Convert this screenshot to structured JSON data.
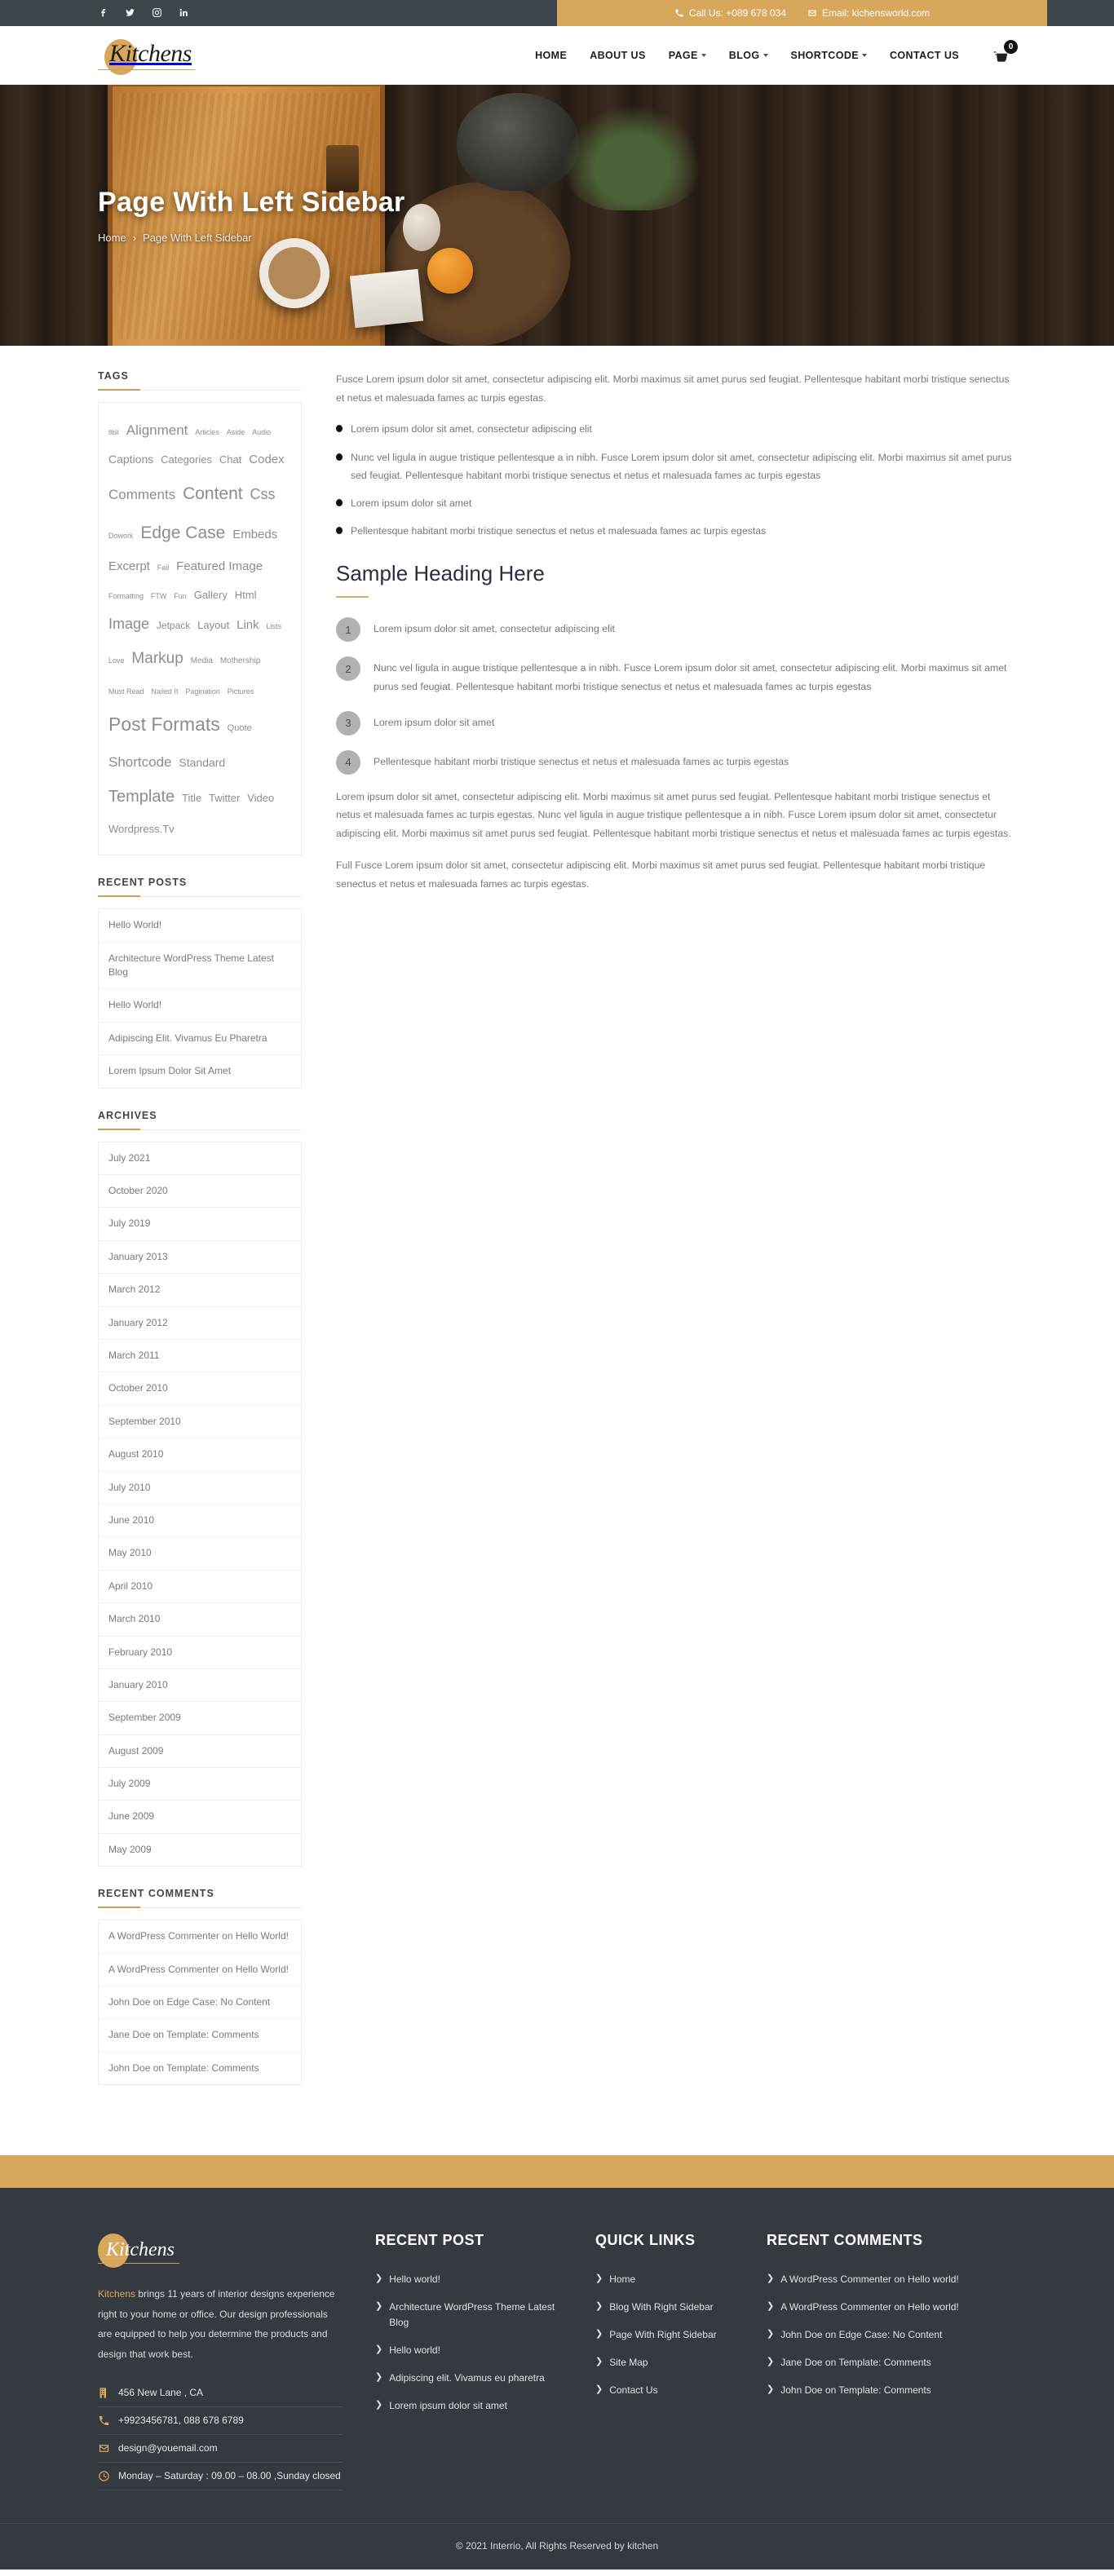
{
  "topbar": {
    "social": [
      {
        "name": "facebook-icon",
        "glyph": "f"
      },
      {
        "name": "twitter-icon",
        "glyph": "t"
      },
      {
        "name": "instagram-icon",
        "glyph": "i"
      },
      {
        "name": "linkedin-icon",
        "glyph": "in"
      }
    ],
    "phone": "Call Us: +089 678 034",
    "email": "Email: kichensworld.com"
  },
  "header": {
    "logo": "Kitchens",
    "nav": [
      {
        "label": "HOME",
        "caret": false
      },
      {
        "label": "ABOUT US",
        "caret": false
      },
      {
        "label": "PAGE",
        "caret": true
      },
      {
        "label": "BLOG",
        "caret": true
      },
      {
        "label": "SHORTCODE",
        "caret": true
      },
      {
        "label": "CONTACT US",
        "caret": false
      }
    ],
    "cart_count": "0"
  },
  "hero": {
    "title": "Page With Left Sidebar",
    "breadcrumb_home": "Home",
    "breadcrumb_sep": "›",
    "breadcrumb_current": "Page With Left Sidebar"
  },
  "sidebar": {
    "tags_title": "TAGS",
    "tags": [
      {
        "label": "8bit",
        "size": 8
      },
      {
        "label": "Alignment",
        "size": 17
      },
      {
        "label": "Articles",
        "size": 9
      },
      {
        "label": "Aside",
        "size": 9
      },
      {
        "label": "Audio",
        "size": 9
      },
      {
        "label": "Captions",
        "size": 14
      },
      {
        "label": "Categories",
        "size": 13
      },
      {
        "label": "Chat",
        "size": 13
      },
      {
        "label": "Codex",
        "size": 15
      },
      {
        "label": "Comments",
        "size": 17
      },
      {
        "label": "Content",
        "size": 21
      },
      {
        "label": "Css",
        "size": 18
      },
      {
        "label": "Dowork",
        "size": 9
      },
      {
        "label": "Edge Case",
        "size": 21
      },
      {
        "label": "Embeds",
        "size": 15
      },
      {
        "label": "Excerpt",
        "size": 15
      },
      {
        "label": "Fail",
        "size": 9
      },
      {
        "label": "Featured Image",
        "size": 15
      },
      {
        "label": "Formatting",
        "size": 9
      },
      {
        "label": "FTW",
        "size": 9
      },
      {
        "label": "Fun",
        "size": 9
      },
      {
        "label": "Gallery",
        "size": 13
      },
      {
        "label": "Html",
        "size": 13
      },
      {
        "label": "Image",
        "size": 18
      },
      {
        "label": "Jetpack",
        "size": 12
      },
      {
        "label": "Layout",
        "size": 13
      },
      {
        "label": "Link",
        "size": 15
      },
      {
        "label": "Lists",
        "size": 9
      },
      {
        "label": "Love",
        "size": 9
      },
      {
        "label": "Markup",
        "size": 19
      },
      {
        "label": "Media",
        "size": 10
      },
      {
        "label": "Mothership",
        "size": 10
      },
      {
        "label": "Must Read",
        "size": 9
      },
      {
        "label": "Nailed It",
        "size": 9
      },
      {
        "label": "Pagination",
        "size": 9
      },
      {
        "label": "Pictures",
        "size": 9
      },
      {
        "label": "Post Formats",
        "size": 23
      },
      {
        "label": "Quote",
        "size": 11
      },
      {
        "label": "Shortcode",
        "size": 17
      },
      {
        "label": "Standard",
        "size": 14
      },
      {
        "label": "Template",
        "size": 20
      },
      {
        "label": "Title",
        "size": 13
      },
      {
        "label": "Twitter",
        "size": 13
      },
      {
        "label": "Video",
        "size": 13
      },
      {
        "label": "Wordpress.Tv",
        "size": 13
      }
    ],
    "recent_posts_title": "RECENT POSTS",
    "recent_posts": [
      "Hello World!",
      "Architecture WordPress Theme Latest Blog",
      "Hello World!",
      "Adipiscing Elit. Vivamus Eu Pharetra",
      "Lorem Ipsum Dolor Sit Amet"
    ],
    "archives_title": "ARCHIVES",
    "archives": [
      "July 2021",
      "October 2020",
      "July 2019",
      "January 2013",
      "March 2012",
      "January 2012",
      "March 2011",
      "October 2010",
      "September 2010",
      "August 2010",
      "July 2010",
      "June 2010",
      "May 2010",
      "April 2010",
      "March 2010",
      "February 2010",
      "January 2010",
      "September 2009",
      "August 2009",
      "July 2009",
      "June 2009",
      "May 2009"
    ],
    "recent_comments_title": "RECENT COMMENTS",
    "recent_comments": [
      "A WordPress Commenter on Hello World!",
      "A WordPress Commenter on Hello World!",
      "John Doe on Edge Case: No Content",
      "Jane Doe on Template: Comments",
      "John Doe on Template: Comments"
    ]
  },
  "content": {
    "intro": "Fusce Lorem ipsum dolor sit amet, consectetur adipiscing elit. Morbi maximus sit amet purus sed feugiat. Pellentesque habitant morbi tristique senectus et netus et malesuada fames ac turpis egestas.",
    "bullets": [
      "Lorem ipsum dolor sit amet, consectetur adipiscing elit",
      "Nunc vel ligula in augue tristique pellentesque a in nibh. Fusce Lorem ipsum dolor sit amet, consectetur adipiscing elit. Morbi maximus sit amet purus sed feugiat. Pellentesque habitant morbi tristique senectus et netus et malesuada fames ac turpis egestas",
      "Lorem ipsum dolor sit amet",
      "Pellentesque habitant morbi tristique senectus et netus et malesuada fames ac turpis egestas"
    ],
    "heading": "Sample Heading Here",
    "numbered": [
      {
        "num": "1",
        "text": "Lorem ipsum dolor sit amet, consectetur adipiscing elit"
      },
      {
        "num": "2",
        "text": "Nunc vel ligula in augue tristique pellentesque a in nibh. Fusce Lorem ipsum dolor sit amet, consectetur adipiscing elit. Morbi maximus sit amet purus sed feugiat. Pellentesque habitant morbi tristique senectus et netus et malesuada fames ac turpis egestas"
      },
      {
        "num": "3",
        "text": "Lorem ipsum dolor sit amet"
      },
      {
        "num": "4",
        "text": "Pellentesque habitant morbi tristique senectus et netus et malesuada fames ac turpis egestas"
      }
    ],
    "para_2": "Lorem ipsum dolor sit amet, consectetur adipiscing elit. Morbi maximus sit amet purus sed feugiat. Pellentesque habitant morbi tristique senectus et netus et malesuada fames ac turpis egestas. Nunc vel ligula in augue tristique pellentesque a in nibh. Fusce Lorem ipsum dolor sit amet, consectetur adipiscing elit. Morbi maximus sit amet purus sed feugiat. Pellentesque habitant morbi tristique senectus et netus et malesuada fames ac turpis egestas.",
    "para_3": "Full Fusce Lorem ipsum dolor sit amet, consectetur adipiscing elit. Morbi maximus sit amet purus sed feugiat. Pellentesque habitant morbi tristique senectus et netus et malesuada fames ac turpis egestas."
  },
  "footer": {
    "logo": "Kitchens",
    "brand_word": "Kitchens",
    "desc": " brings 11 years of interior designs experience right to your home or office. Our design professionals are equipped to help you determine the products and design that work best.",
    "address": "456 New Lane , CA",
    "phone": "+9923456781, 088 678 6789",
    "email": "design@youemail.com",
    "hours": "Monday – Saturday : 09.00 – 08.00 ,Sunday closed",
    "recent_post_title": "RECENT POST",
    "recent_posts": [
      "Hello world!",
      "Architecture WordPress Theme Latest Blog",
      "Hello world!",
      "Adipiscing elit. Vivamus eu pharetra",
      "Lorem ipsum dolor sit amet"
    ],
    "quick_links_title": "QUICK LINKS",
    "quick_links": [
      "Home",
      "Blog With Right Sidebar",
      "Page With Right Sidebar",
      "Site Map",
      "Contact Us"
    ],
    "recent_comments_title": "RECENT COMMENTS",
    "recent_comments": [
      "A WordPress Commenter on Hello world!",
      "A WordPress Commenter on Hello world!",
      "John Doe on Edge Case: No Content",
      "Jane Doe on Template: Comments",
      "John Doe on Template: Comments"
    ],
    "copyright": "© 2021 Interrio, All Rights Reserved by kitchen"
  },
  "colors": {
    "accent": "#d7a85c",
    "dark": "#343a40",
    "topbar_dark": "#3e464c"
  }
}
